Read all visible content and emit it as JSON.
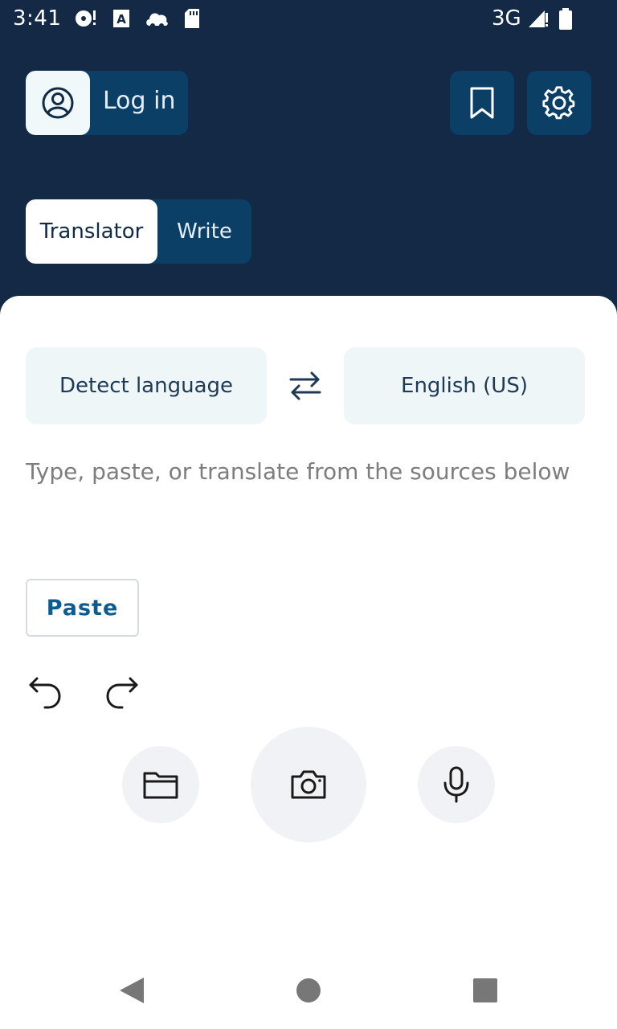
{
  "status_bar": {
    "time": "3:41",
    "network": "3G",
    "icons": [
      "media-icon",
      "font-icon",
      "cloud-icon",
      "sd-card-icon",
      "signal-icon",
      "battery-icon"
    ]
  },
  "header": {
    "login_label": "Log in",
    "avatar_icon": "account-circle-icon",
    "bookmark_icon": "bookmark-icon",
    "settings_icon": "gear-icon"
  },
  "mode_tabs": {
    "translator": "Translator",
    "write": "Write",
    "selected": "Translator"
  },
  "languages": {
    "source": "Detect language",
    "target": "English (US)",
    "swap_icon": "swap-arrows-icon"
  },
  "input": {
    "placeholder": "Type, paste, or translate from the sources below",
    "value": ""
  },
  "actions": {
    "paste_label": "Paste",
    "undo_icon": "undo-icon",
    "redo_icon": "redo-icon",
    "file_icon": "folder-icon",
    "camera_icon": "camera-icon",
    "mic_icon": "microphone-icon"
  },
  "navigation": [
    "back-icon",
    "home-icon",
    "recents-icon"
  ],
  "colors": {
    "header_bg": "#132945",
    "button_bg": "#0c3f66",
    "language_bg": "#eef6f8",
    "accent": "#0d5c8f"
  }
}
